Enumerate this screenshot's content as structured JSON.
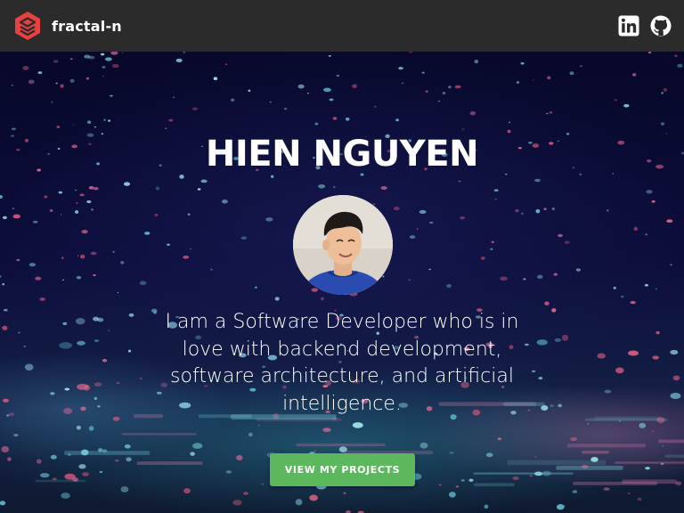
{
  "navbar": {
    "brand_name": "fractal-n",
    "brand_icon": "fractal-logo-icon",
    "icons": [
      "linkedin-icon",
      "github-icon"
    ]
  },
  "hero": {
    "title": "HIEN NGUYEN",
    "tagline": "I am a Software Developer who is in love with backend development, software architecture, and artificial intelligence.",
    "cta_label": "VIEW MY PROJECTS"
  },
  "colors": {
    "navbar_bg": "#2b2b2b",
    "brand_accent": "#e8413f",
    "cta_bg": "#5cb85c",
    "hero_bg": "#0b0a2a"
  }
}
